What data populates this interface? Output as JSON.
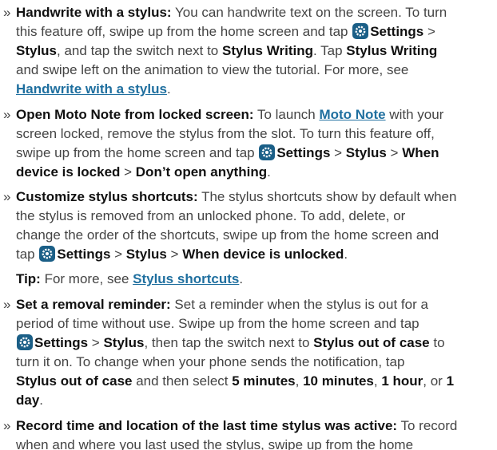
{
  "bullet_glyph": "»",
  "colors": {
    "text": "#444444",
    "bold": "#111111",
    "link": "#1f6f9f",
    "settings_icon": "#1b5f87"
  },
  "icon": "settings-gear-icon",
  "items": [
    {
      "title": "Handwrite with a stylus:",
      "lines": [
        " You can handwrite text on the screen. To turn",
        "this feature off, swipe up from the home screen and tap ",
        "Settings",
        " > ",
        "Stylus",
        ", and tap the switch next to ",
        "Stylus Writing",
        ". Tap ",
        "Stylus Writing",
        "and swipe left on the animation to view the tutorial. For more, see",
        "Handwrite with a stylus",
        "."
      ]
    },
    {
      "title": "Open Moto Note from locked screen:",
      "lines": [
        " To launch ",
        "Moto Note",
        " with your",
        "screen locked, remove the stylus from the slot. To turn this feature off,",
        "swipe up from the home screen and tap ",
        "Settings",
        " > ",
        "Stylus",
        " > ",
        "When",
        "device is locked",
        " > ",
        "Don’t open anything",
        "."
      ]
    },
    {
      "title": "Customize stylus shortcuts:",
      "lines": [
        " The stylus shortcuts show by default when",
        "the stylus is removed from an unlocked phone. To add, delete, or",
        "change the order of the shortcuts, swipe up from the home screen and",
        "tap ",
        "Settings",
        " > ",
        "Stylus",
        " > ",
        "When device is unlocked",
        "."
      ]
    },
    {
      "tip_label": "Tip:",
      "tip_text": " For more, see ",
      "tip_link": "Stylus shortcuts",
      "tip_end": "."
    },
    {
      "title": "Set a removal reminder:",
      "lines": [
        " Set a reminder when the stylus is out for a",
        "period of time without use. Swipe up from the home screen and tap",
        "Settings",
        " > ",
        "Stylus",
        ", then tap the switch next to ",
        "Stylus out of case",
        " to",
        "turn it on. To change when your phone sends the notification, tap",
        "Stylus out of case",
        " and then select ",
        "5 minutes",
        ", ",
        "10 minutes",
        ", ",
        "1 hour",
        ", or ",
        "1",
        "day",
        "."
      ]
    },
    {
      "title": "Record time and location of the last time stylus was active:",
      "lines": [
        " To record",
        "when and where you last used the stylus, swipe up from the home"
      ]
    }
  ]
}
